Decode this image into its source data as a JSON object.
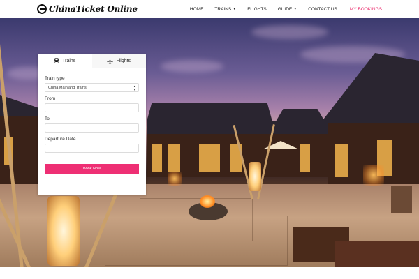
{
  "header": {
    "logo_text": "ChinaTicket Online",
    "nav": [
      {
        "label": "HOME",
        "caret": false
      },
      {
        "label": "TRAINS",
        "caret": true
      },
      {
        "label": "FLIGHTS",
        "caret": false
      },
      {
        "label": "GUIDE",
        "caret": true
      },
      {
        "label": "CONTACT US",
        "caret": false
      }
    ],
    "my_bookings": "MY BOOKINGS"
  },
  "booking": {
    "tabs": {
      "trains": "Trains",
      "flights": "Flights"
    },
    "train_type_label": "Train type",
    "train_type_value": "China Mainland Trains",
    "from_label": "From",
    "to_label": "To",
    "departure_label": "Departure Date",
    "book_button": "Book Now"
  },
  "colors": {
    "accent": "#ee2f74",
    "nav_highlight": "#e91e63"
  },
  "icons": {
    "train": "train-icon",
    "flight": "airplane-icon"
  }
}
